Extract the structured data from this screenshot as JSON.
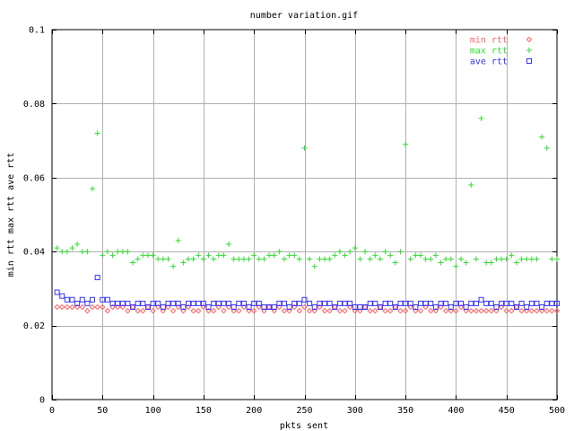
{
  "chart_data": {
    "type": "scatter",
    "title": "number variation.gif",
    "xlabel": "pkts sent",
    "ylabel": "min rtt max rtt ave rtt",
    "xlim": [
      0,
      500
    ],
    "ylim": [
      0,
      0.1
    ],
    "xticks": [
      0,
      50,
      100,
      150,
      200,
      250,
      300,
      350,
      400,
      450,
      500
    ],
    "yticks": [
      0,
      0.02,
      0.04,
      0.06,
      0.08,
      0.1
    ],
    "grid": true,
    "legend_position": "top-right",
    "series": [
      {
        "name": "min rtt",
        "marker": "diamond",
        "color": "#ff6666",
        "x": [
          5,
          10,
          15,
          20,
          25,
          30,
          35,
          40,
          45,
          50,
          55,
          60,
          65,
          70,
          75,
          80,
          85,
          90,
          95,
          100,
          105,
          110,
          115,
          120,
          125,
          130,
          135,
          140,
          145,
          150,
          155,
          160,
          165,
          170,
          175,
          180,
          185,
          190,
          195,
          200,
          205,
          210,
          215,
          220,
          225,
          230,
          235,
          240,
          245,
          250,
          255,
          260,
          265,
          270,
          275,
          280,
          285,
          290,
          295,
          300,
          305,
          310,
          315,
          320,
          325,
          330,
          335,
          340,
          345,
          350,
          355,
          360,
          365,
          370,
          375,
          380,
          385,
          390,
          395,
          400,
          405,
          410,
          415,
          420,
          425,
          430,
          435,
          440,
          445,
          450,
          455,
          460,
          465,
          470,
          475,
          480,
          485,
          490,
          495,
          500
        ],
        "y": [
          0.025,
          0.025,
          0.025,
          0.025,
          0.025,
          0.025,
          0.024,
          0.025,
          0.025,
          0.025,
          0.024,
          0.025,
          0.025,
          0.025,
          0.024,
          0.025,
          0.024,
          0.024,
          0.025,
          0.024,
          0.025,
          0.024,
          0.025,
          0.024,
          0.025,
          0.024,
          0.025,
          0.024,
          0.024,
          0.025,
          0.024,
          0.024,
          0.025,
          0.024,
          0.025,
          0.024,
          0.024,
          0.025,
          0.024,
          0.024,
          0.025,
          0.024,
          0.025,
          0.024,
          0.025,
          0.024,
          0.024,
          0.025,
          0.024,
          0.025,
          0.024,
          0.024,
          0.025,
          0.024,
          0.024,
          0.025,
          0.024,
          0.024,
          0.025,
          0.024,
          0.024,
          0.025,
          0.024,
          0.024,
          0.025,
          0.024,
          0.024,
          0.025,
          0.024,
          0.024,
          0.025,
          0.024,
          0.024,
          0.025,
          0.024,
          0.024,
          0.025,
          0.024,
          0.024,
          0.024,
          0.025,
          0.024,
          0.024,
          0.024,
          0.024,
          0.024,
          0.024,
          0.024,
          0.025,
          0.024,
          0.024,
          0.025,
          0.024,
          0.024,
          0.024,
          0.024,
          0.024,
          0.024,
          0.024,
          0.024
        ]
      },
      {
        "name": "max rtt",
        "marker": "plus",
        "color": "#33dd33",
        "x": [
          5,
          10,
          15,
          20,
          25,
          30,
          35,
          40,
          45,
          50,
          55,
          60,
          65,
          70,
          75,
          80,
          85,
          90,
          95,
          100,
          105,
          110,
          115,
          120,
          125,
          130,
          135,
          140,
          145,
          150,
          155,
          160,
          165,
          170,
          175,
          180,
          185,
          190,
          195,
          200,
          205,
          210,
          215,
          220,
          225,
          230,
          235,
          240,
          245,
          250,
          255,
          260,
          265,
          270,
          275,
          280,
          285,
          290,
          295,
          300,
          305,
          310,
          315,
          320,
          325,
          330,
          335,
          340,
          345,
          350,
          355,
          360,
          365,
          370,
          375,
          380,
          385,
          390,
          395,
          400,
          405,
          410,
          415,
          420,
          425,
          430,
          435,
          440,
          445,
          450,
          455,
          460,
          465,
          470,
          475,
          480,
          485,
          490,
          495,
          500
        ],
        "y": [
          0.041,
          0.04,
          0.04,
          0.041,
          0.042,
          0.04,
          0.04,
          0.057,
          0.072,
          0.039,
          0.04,
          0.039,
          0.04,
          0.04,
          0.04,
          0.037,
          0.038,
          0.039,
          0.039,
          0.039,
          0.038,
          0.038,
          0.038,
          0.036,
          0.043,
          0.037,
          0.038,
          0.038,
          0.039,
          0.038,
          0.039,
          0.038,
          0.039,
          0.039,
          0.042,
          0.038,
          0.038,
          0.038,
          0.038,
          0.039,
          0.038,
          0.038,
          0.039,
          0.039,
          0.04,
          0.038,
          0.039,
          0.039,
          0.038,
          0.068,
          0.038,
          0.036,
          0.038,
          0.038,
          0.038,
          0.039,
          0.04,
          0.039,
          0.04,
          0.041,
          0.038,
          0.04,
          0.038,
          0.039,
          0.038,
          0.04,
          0.039,
          0.037,
          0.04,
          0.069,
          0.038,
          0.039,
          0.039,
          0.038,
          0.038,
          0.039,
          0.037,
          0.038,
          0.038,
          0.036,
          0.038,
          0.037,
          0.058,
          0.038,
          0.076,
          0.037,
          0.037,
          0.038,
          0.038,
          0.038,
          0.039,
          0.037,
          0.038,
          0.038,
          0.038,
          0.038,
          0.071,
          0.068,
          0.038,
          0.038
        ]
      },
      {
        "name": "ave rtt",
        "marker": "square",
        "color": "#3333ff",
        "x": [
          5,
          10,
          15,
          20,
          25,
          30,
          35,
          40,
          45,
          50,
          55,
          60,
          65,
          70,
          75,
          80,
          85,
          90,
          95,
          100,
          105,
          110,
          115,
          120,
          125,
          130,
          135,
          140,
          145,
          150,
          155,
          160,
          165,
          170,
          175,
          180,
          185,
          190,
          195,
          200,
          205,
          210,
          215,
          220,
          225,
          230,
          235,
          240,
          245,
          250,
          255,
          260,
          265,
          270,
          275,
          280,
          285,
          290,
          295,
          300,
          305,
          310,
          315,
          320,
          325,
          330,
          335,
          340,
          345,
          350,
          355,
          360,
          365,
          370,
          375,
          380,
          385,
          390,
          395,
          400,
          405,
          410,
          415,
          420,
          425,
          430,
          435,
          440,
          445,
          450,
          455,
          460,
          465,
          470,
          475,
          480,
          485,
          490,
          495,
          500
        ],
        "y": [
          0.029,
          0.028,
          0.027,
          0.027,
          0.026,
          0.027,
          0.026,
          0.027,
          0.033,
          0.027,
          0.027,
          0.026,
          0.026,
          0.026,
          0.026,
          0.025,
          0.026,
          0.026,
          0.025,
          0.026,
          0.026,
          0.025,
          0.026,
          0.026,
          0.026,
          0.025,
          0.026,
          0.026,
          0.026,
          0.026,
          0.025,
          0.026,
          0.026,
          0.026,
          0.026,
          0.025,
          0.026,
          0.026,
          0.025,
          0.026,
          0.026,
          0.025,
          0.025,
          0.025,
          0.026,
          0.026,
          0.025,
          0.026,
          0.026,
          0.027,
          0.026,
          0.025,
          0.026,
          0.026,
          0.026,
          0.025,
          0.026,
          0.026,
          0.026,
          0.025,
          0.025,
          0.025,
          0.026,
          0.026,
          0.025,
          0.026,
          0.026,
          0.025,
          0.026,
          0.026,
          0.026,
          0.025,
          0.026,
          0.026,
          0.026,
          0.025,
          0.026,
          0.026,
          0.025,
          0.026,
          0.026,
          0.025,
          0.026,
          0.026,
          0.027,
          0.026,
          0.026,
          0.025,
          0.026,
          0.026,
          0.026,
          0.025,
          0.026,
          0.025,
          0.026,
          0.026,
          0.025,
          0.026,
          0.026,
          0.026
        ]
      }
    ]
  }
}
